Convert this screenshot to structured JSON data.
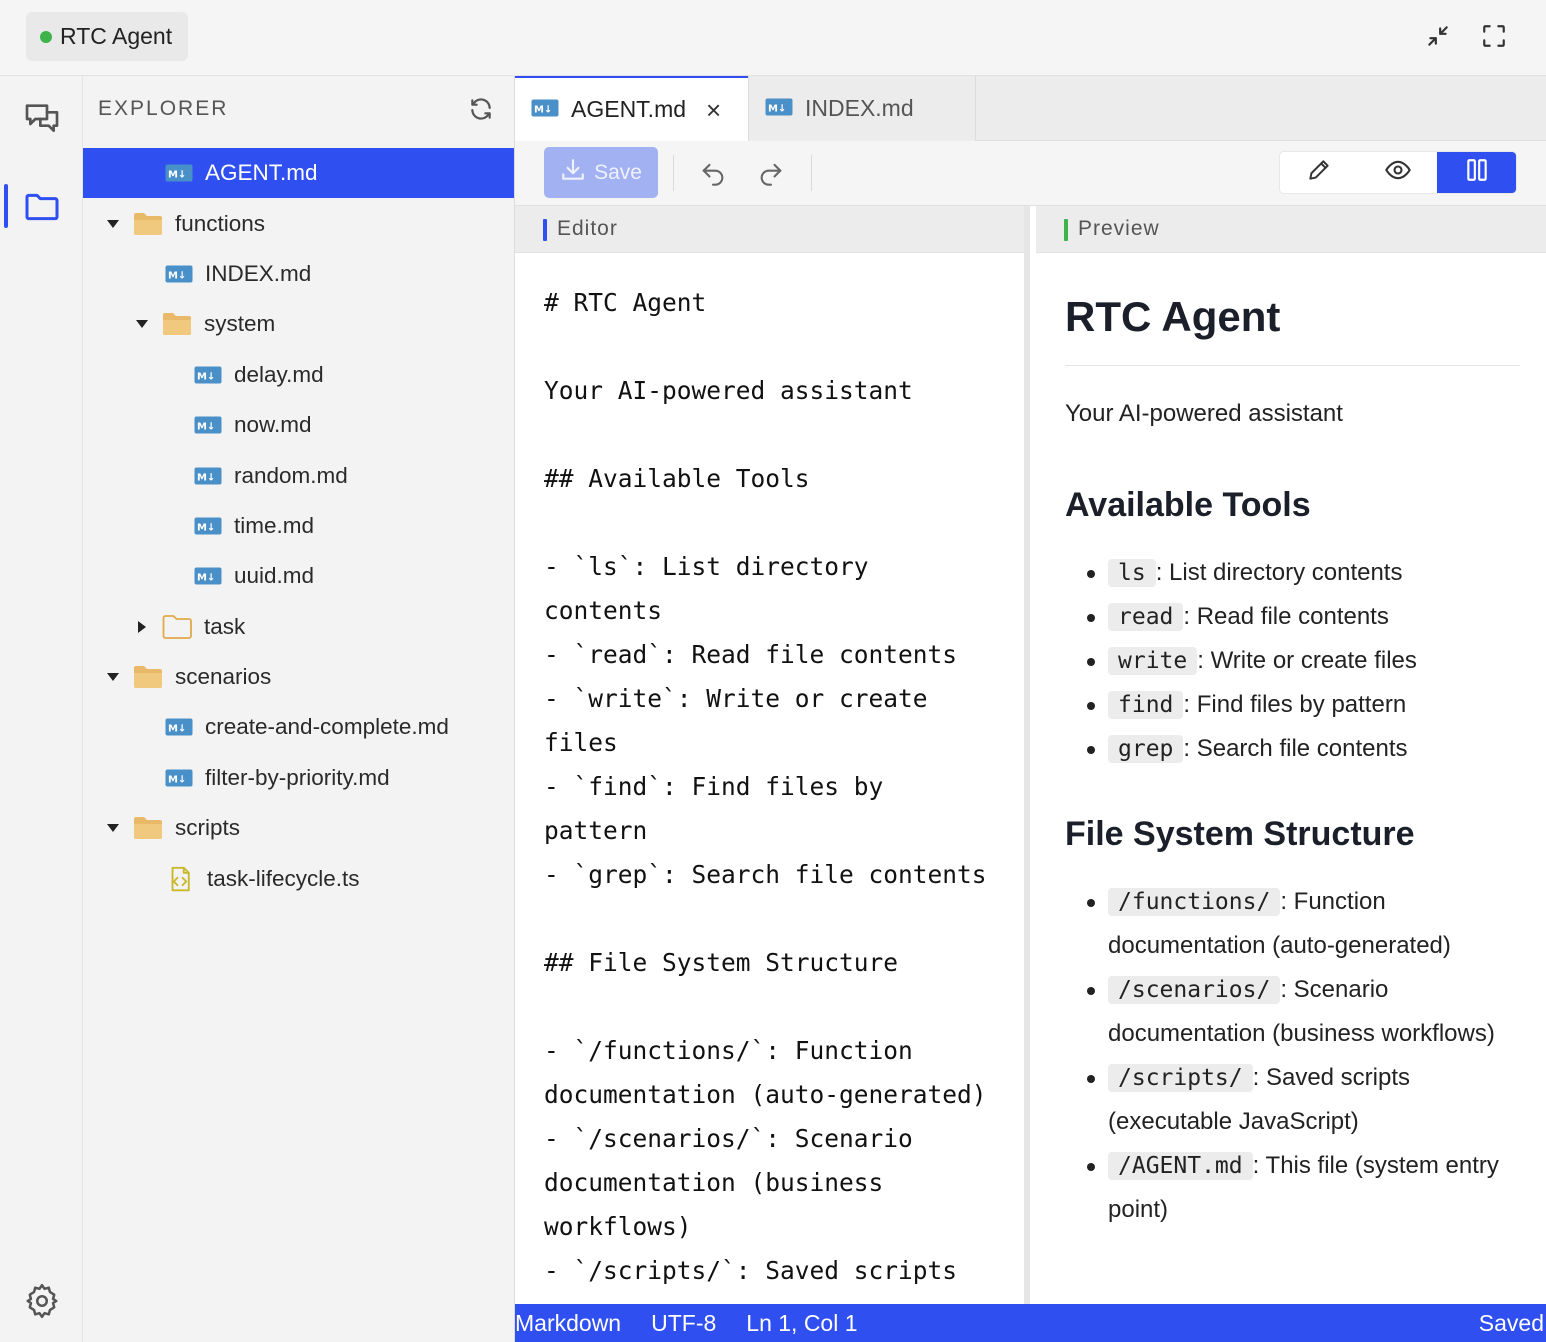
{
  "title_bar": {
    "app_name": "RTC Agent",
    "status_color": "#3db34a"
  },
  "activity_bar": {
    "items": [
      "chat-icon",
      "folder-icon"
    ],
    "settings": "gear-icon"
  },
  "explorer": {
    "header": "EXPLORER",
    "tree": [
      {
        "name": "AGENT.md",
        "type": "md",
        "selected": true
      },
      {
        "name": "functions",
        "type": "folder",
        "expanded": true
      },
      {
        "name": "INDEX.md",
        "type": "md"
      },
      {
        "name": "system",
        "type": "folder",
        "expanded": true
      },
      {
        "name": "delay.md",
        "type": "md"
      },
      {
        "name": "now.md",
        "type": "md"
      },
      {
        "name": "random.md",
        "type": "md"
      },
      {
        "name": "time.md",
        "type": "md"
      },
      {
        "name": "uuid.md",
        "type": "md"
      },
      {
        "name": "task",
        "type": "folder",
        "expanded": false
      },
      {
        "name": "scenarios",
        "type": "folder",
        "expanded": true
      },
      {
        "name": "create-and-complete.md",
        "type": "md"
      },
      {
        "name": "filter-by-priority.md",
        "type": "md"
      },
      {
        "name": "scripts",
        "type": "folder",
        "expanded": true
      },
      {
        "name": "task-lifecycle.ts",
        "type": "ts"
      }
    ]
  },
  "tabs": [
    {
      "label": "AGENT.md",
      "active": true
    },
    {
      "label": "INDEX.md",
      "active": false
    }
  ],
  "toolbar": {
    "save_label": "Save",
    "view_modes": [
      "edit",
      "preview",
      "split"
    ],
    "active_mode": "split"
  },
  "editor": {
    "header": "Editor",
    "lines": [
      "# RTC Agent",
      "",
      "Your AI-powered assistant",
      "",
      "## Available Tools",
      "",
      "- `ls`: List directory",
      "contents",
      "- `read`: Read file contents",
      "- `write`: Write or create",
      "files",
      "- `find`: Find files by",
      "pattern",
      "- `grep`: Search file contents",
      "",
      "## File System Structure",
      "",
      "- `/functions/`: Function",
      "documentation (auto-generated)",
      "- `/scenarios/`: Scenario",
      "documentation (business",
      "workflows)",
      "- `/scripts/`: Saved scripts"
    ]
  },
  "preview": {
    "header": "Preview",
    "h1": "RTC Agent",
    "intro": "Your AI-powered assistant",
    "tools_heading": "Available Tools",
    "tools": [
      {
        "code": "ls",
        "desc": ": List directory contents"
      },
      {
        "code": "read",
        "desc": ": Read file contents"
      },
      {
        "code": "write",
        "desc": ": Write or create files"
      },
      {
        "code": "find",
        "desc": ": Find files by pattern"
      },
      {
        "code": "grep",
        "desc": ": Search file contents"
      }
    ],
    "fs_heading": "File System Structure",
    "fs": [
      {
        "code": "/functions/",
        "desc": ": Function documentation (auto-generated)"
      },
      {
        "code": "/scenarios/",
        "desc": ": Scenario documentation (business workflows)"
      },
      {
        "code": "/scripts/",
        "desc": ": Saved scripts (executable JavaScript)"
      },
      {
        "code": "/AGENT.md",
        "desc": ": This file (system entry point)"
      }
    ]
  },
  "status_bar": {
    "language": "Markdown",
    "encoding": "UTF-8",
    "position": "Ln 1, Col 1",
    "save_state": "Saved"
  },
  "colors": {
    "accent": "#2f4ff0",
    "editor_marker": "#2f4ff0",
    "preview_marker": "#3db34a"
  }
}
